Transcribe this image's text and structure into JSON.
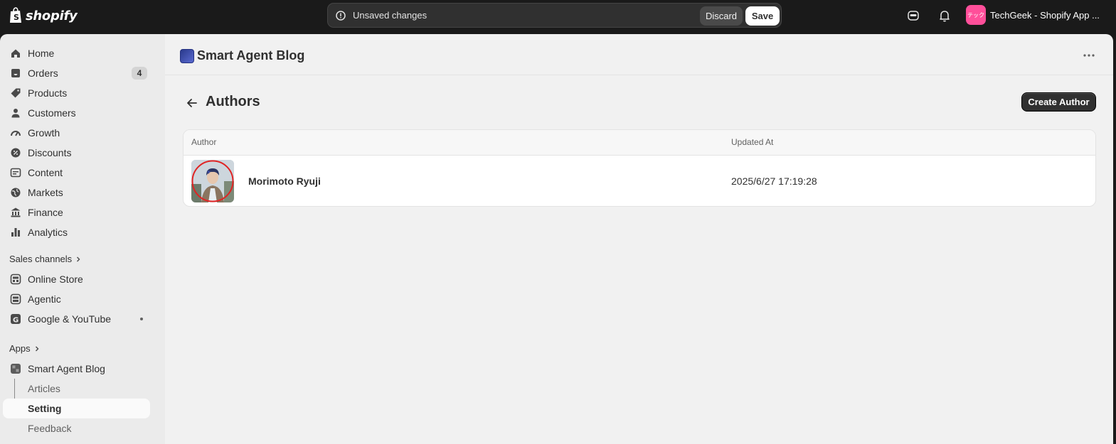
{
  "topbar": {
    "brand": "shopify",
    "save_bar": {
      "message": "Unsaved changes",
      "discard_label": "Discard",
      "save_label": "Save"
    },
    "store": {
      "avatar_text": "テック",
      "name": "TechGeek - Shopify App ..."
    }
  },
  "sidebar": {
    "items": [
      {
        "label": "Home",
        "icon": "home-icon"
      },
      {
        "label": "Orders",
        "icon": "inbox-icon",
        "badge": "4"
      },
      {
        "label": "Products",
        "icon": "tag-icon"
      },
      {
        "label": "Customers",
        "icon": "person-icon"
      },
      {
        "label": "Growth",
        "icon": "gauge-icon"
      },
      {
        "label": "Discounts",
        "icon": "discount-icon"
      },
      {
        "label": "Content",
        "icon": "content-icon"
      },
      {
        "label": "Markets",
        "icon": "globe-icon"
      },
      {
        "label": "Finance",
        "icon": "bank-icon"
      },
      {
        "label": "Analytics",
        "icon": "bar-chart-icon"
      }
    ],
    "sales_channels_label": "Sales channels",
    "sales_channels": [
      {
        "label": "Online Store",
        "icon": "store-icon"
      },
      {
        "label": "Agentic",
        "icon": "agentic-icon"
      },
      {
        "label": "Google & YouTube",
        "icon": "google-icon"
      }
    ],
    "apps_label": "Apps",
    "apps": [
      {
        "label": "Smart Agent Blog",
        "icon": "app-icon"
      }
    ],
    "app_subitems": [
      "Articles",
      "Setting",
      "Feedback"
    ]
  },
  "main": {
    "app_title": "Smart Agent Blog",
    "page_title": "Authors",
    "create_button": "Create Author",
    "table": {
      "headers": [
        "Author",
        "Updated At"
      ],
      "rows": [
        {
          "author": "Morimoto Ryuji",
          "updated_at": "2025/6/27 17:19:28"
        }
      ]
    }
  },
  "colors": {
    "topbar": "#1a1a1a",
    "sidebar": "#ebebeb",
    "main": "#f1f1f1",
    "primary_button": "#303030",
    "avatar_highlight": "#e02424"
  }
}
